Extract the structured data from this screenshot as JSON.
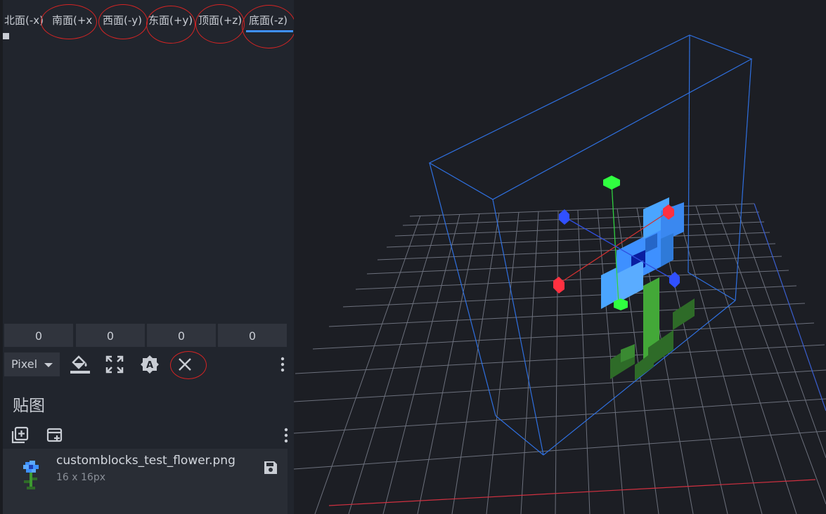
{
  "uv_panel": {
    "face_tabs": [
      "北面(-x)",
      "南面(+x",
      "西面(-y)",
      "东面(+y)",
      "顶面(+z)",
      "底面(-z)"
    ],
    "selected_tab": "底面(-z)",
    "uv_values": [
      "0",
      "0",
      "0",
      "0"
    ],
    "mode": "Pixel",
    "tools": {
      "fill_icon": "paint-bucket-icon",
      "maximize_icon": "expand-icon",
      "auto_uv_icon": "auto-uv-icon",
      "clear_icon": "close-icon",
      "menu_icon": "more-vert-icon"
    }
  },
  "textures_panel": {
    "title": "贴图",
    "add_icon": "add-texture-icon",
    "create_icon": "create-texture-icon",
    "menu_icon": "more-vert-icon",
    "items": [
      {
        "name": "customblocks_test_flower.png",
        "size": "16 x 16px",
        "save_icon": "save-icon"
      }
    ]
  },
  "viewport": {
    "accent_color": "#3e90ff",
    "axis_colors": {
      "x": "#ff3030",
      "y": "#30ff40",
      "z": "#3050ff"
    }
  }
}
